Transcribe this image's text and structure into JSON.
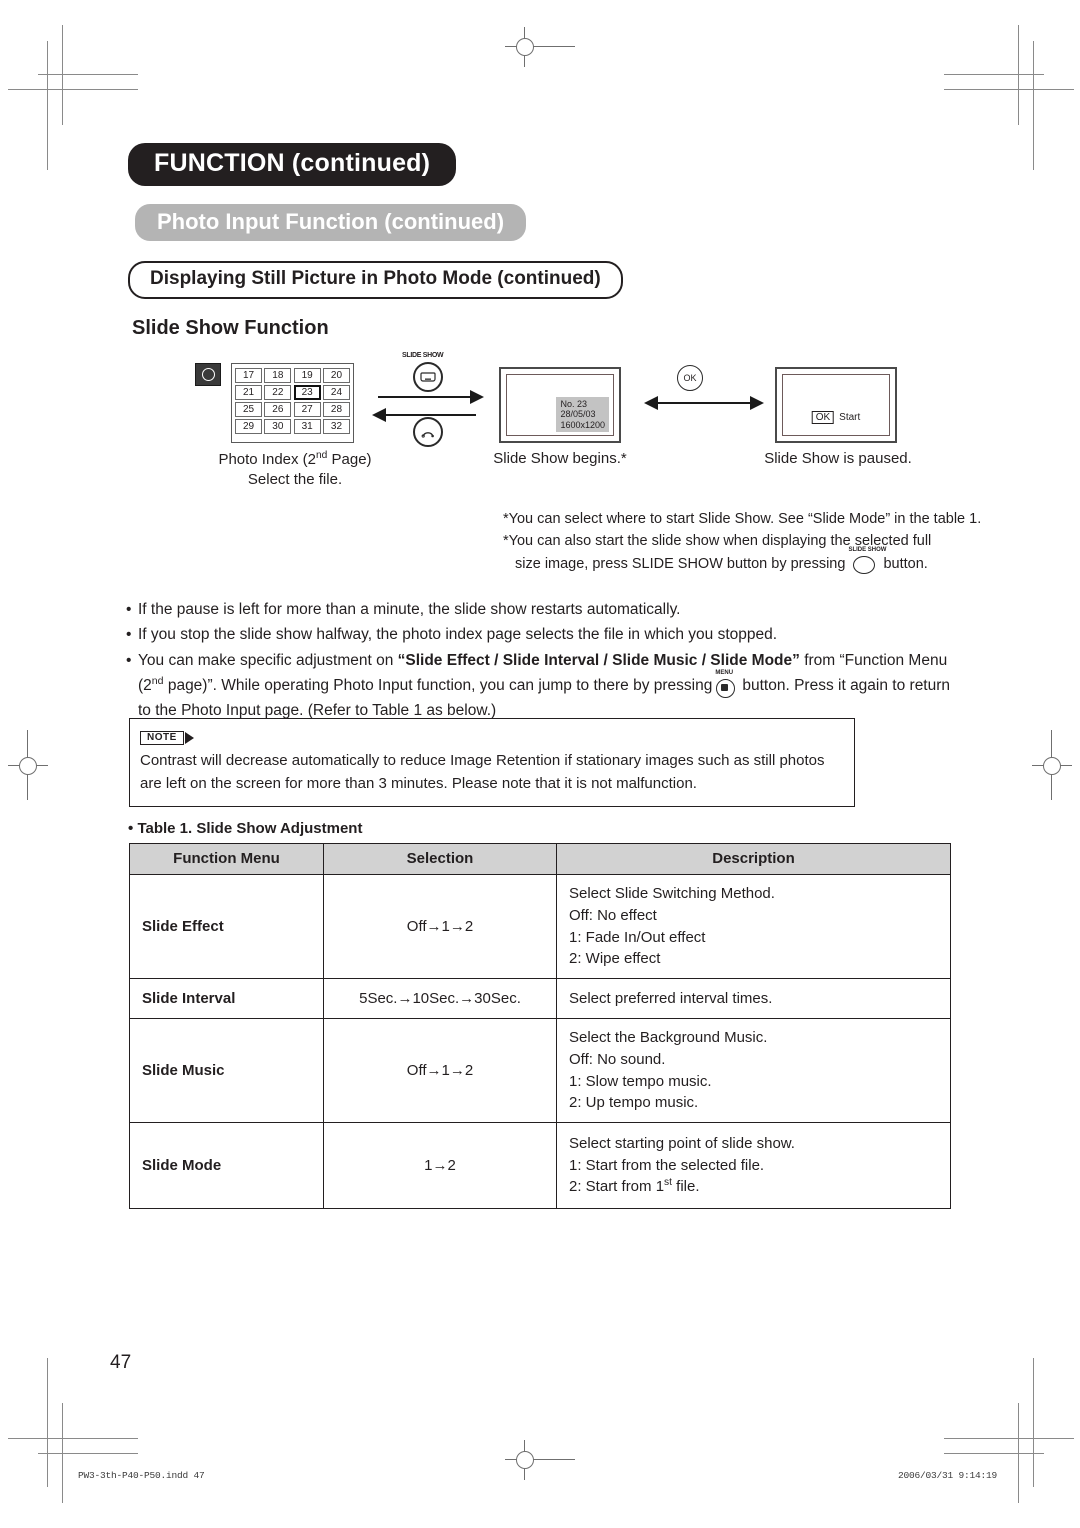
{
  "headers": {
    "chapter": "FUNCTION (continued)",
    "section": "Photo Input Function (continued)",
    "subsection": "Displaying Still Picture in Photo Mode (continued)",
    "topic": "Slide Show Function"
  },
  "diagram": {
    "camera_icon": "camera-icon",
    "index_thumbnails": [
      [
        "17",
        "18",
        "19",
        "20"
      ],
      [
        "21",
        "22",
        "23",
        "24"
      ],
      [
        "25",
        "26",
        "27",
        "28"
      ],
      [
        "29",
        "30",
        "31",
        "32"
      ]
    ],
    "selected_thumbnail": "23",
    "index_caption_line1": "Photo Index (2",
    "index_caption_ord": "nd",
    "index_caption_line1b": " Page)",
    "index_caption_line2": "Select the file.",
    "slideshow_button_label": "SLIDE SHOW",
    "return_button_label": "return-icon",
    "ok_button_label": "OK",
    "tv_osd": "No. 23\n28/05/03\n1600x1200",
    "tv_caption": "Slide Show begins.*",
    "paused_ok_label": "OK",
    "paused_start_label": "Start",
    "paused_caption": "Slide Show is paused."
  },
  "star_notes": {
    "line1": "*You can select where to start Slide Show. See “Slide Mode” in the table 1.",
    "line2": "*You can also start the slide show when displaying the selected full",
    "line3a": "size image, press SLIDE SHOW button by pressing",
    "line3_button": "SLIDE SHOW",
    "line3b": "button."
  },
  "bullets": {
    "marker": "•",
    "item1": "If the pause is left for more than a minute, the slide show restarts automatically.",
    "item2": "If you stop the slide show halfway, the photo index page selects the file in which you stopped.",
    "item3_a": "You can make specific adjustment on ",
    "item3_bold": "“Slide Effect / Slide Interval / Slide Music / Slide Mode”",
    "item3_b": " from “Function Menu (2",
    "item3_ord": "nd",
    "item3_c": " page)”. While operating Photo Input function, you can jump to there by pressing",
    "item3_button": "MENU",
    "item3_d": "button.  Press it again to return to the Photo Input page. (Refer to Table 1 as below.)"
  },
  "note": {
    "tag": "NOTE",
    "text": "Contrast will decrease automatically to reduce Image Retention if stationary images such as still photos are left on the screen for more than 3 minutes. Please note that it is not malfunction."
  },
  "table": {
    "caption_marker": "•",
    "caption": "Table 1. Slide Show Adjustment",
    "headers": [
      "Function Menu",
      "Selection",
      "Description"
    ],
    "rows": [
      {
        "function": "Slide Effect",
        "selection": "Off→1→2",
        "description": "Select Slide Switching Method.\nOff: No effect\n1: Fade In/Out effect\n2: Wipe effect"
      },
      {
        "function": "Slide Interval",
        "selection": "5Sec.→10Sec.→30Sec.",
        "description": "Select preferred interval times."
      },
      {
        "function": "Slide Music",
        "selection": "Off→1→2",
        "description": "Select the Background Music.\nOff: No sound.\n1: Slow tempo music.\n2: Up tempo music."
      },
      {
        "function": "Slide Mode",
        "selection": "1→2",
        "description_line1": "Select starting point of slide show.",
        "description_line2": "1: Start from the selected file.",
        "description_line3a": "2: Start from 1",
        "description_line3_ord": "st",
        "description_line3b": " file."
      }
    ]
  },
  "page_number": "47",
  "footer": {
    "left": "PW3-3th-P40-P50.indd   47",
    "right": "2006/03/31   9:14:19"
  },
  "colors": {
    "header_black": "#231f20",
    "header_gray": "#b4b4b4",
    "table_header_bg": "#d2d2d2",
    "osd_bg": "#c3c3c3"
  }
}
